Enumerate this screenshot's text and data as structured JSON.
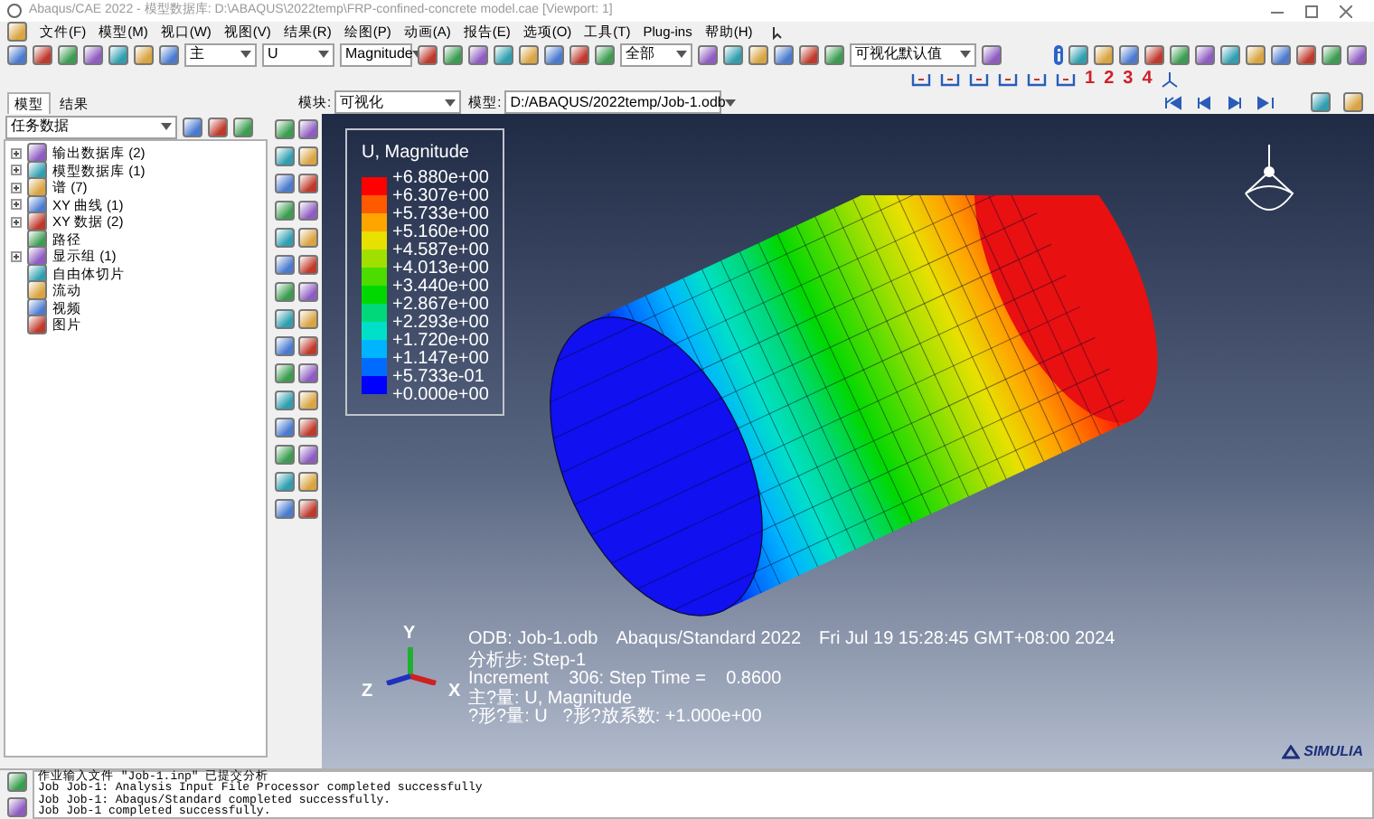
{
  "window": {
    "title": "Abaqus/CAE 2022 - 模型数据库: D:\\ABAQUS\\2022temp\\FRP-confined-concrete model.cae [Viewport: 1]"
  },
  "menu": [
    "文件(F)",
    "模型(M)",
    "视口(W)",
    "视图(V)",
    "结果(R)",
    "绘图(P)",
    "动画(A)",
    "报告(E)",
    "选项(O)",
    "工具(T)",
    "Plug-ins",
    "帮助(H)"
  ],
  "toolbar": {
    "step_combo": "主",
    "variable_combo": "U",
    "component_combo": "Magnitude",
    "selection_combo": "全部",
    "defaults_combo": "可视化默认值",
    "view_numbers": [
      "1",
      "2",
      "3",
      "4"
    ]
  },
  "context_bar": {
    "module_label": "模块:",
    "module": "可视化",
    "model_label": "模型:",
    "model": "D:/ABAQUS/2022temp/Job-1.odb"
  },
  "tabs": [
    {
      "label": "模型",
      "selected": true
    },
    {
      "label": "结果",
      "selected": false
    }
  ],
  "tree": {
    "filter": "任务数据",
    "items": [
      {
        "label": "输出数据库 (2)",
        "expandable": true
      },
      {
        "label": "模型数据库 (1)",
        "expandable": true
      },
      {
        "label": "谱 (7)",
        "expandable": true
      },
      {
        "label": "XY 曲线 (1)",
        "expandable": true
      },
      {
        "label": "XY 数据 (2)",
        "expandable": true
      },
      {
        "label": "路径",
        "expandable": false
      },
      {
        "label": "显示组 (1)",
        "expandable": true
      },
      {
        "label": "自由体切片",
        "expandable": false
      },
      {
        "label": "流动",
        "expandable": false
      },
      {
        "label": "视频",
        "expandable": false
      },
      {
        "label": "图片",
        "expandable": false
      }
    ]
  },
  "legend": {
    "title": "U, Magnitude",
    "values": [
      "+6.880e+00",
      "+6.307e+00",
      "+5.733e+00",
      "+5.160e+00",
      "+4.587e+00",
      "+4.013e+00",
      "+3.440e+00",
      "+2.867e+00",
      "+2.293e+00",
      "+1.720e+00",
      "+1.147e+00",
      "+5.733e-01",
      "+0.000e+00"
    ],
    "bands": [
      {
        "color": "#ff0000"
      },
      {
        "color": "#ff5a00"
      },
      {
        "color": "#ffa500"
      },
      {
        "color": "#e8e000"
      },
      {
        "color": "#a0e000"
      },
      {
        "color": "#4cdc00"
      },
      {
        "color": "#00d800"
      },
      {
        "color": "#00d87a"
      },
      {
        "color": "#00e0c8"
      },
      {
        "color": "#00b4ff"
      },
      {
        "color": "#006cff"
      },
      {
        "color": "#0000ff"
      }
    ]
  },
  "info": {
    "header": [
      "ODB: Job-1.odb",
      "Abaqus/Standard 2022",
      "Fri Jul 19 15:28:45 GMT+08:00 2024"
    ],
    "lines": [
      "分析步: Step-1",
      "Increment    306: Step Time =    0.8600",
      "主?量: U, Magnitude",
      "?形?量: U   ?形?放系数: +1.000e+00"
    ]
  },
  "triad": {
    "y": "Y",
    "x": "X",
    "z": "Z"
  },
  "brand": "SIMULIA",
  "messages": [
    "作业输入文件 \"Job-1.inp\" 已提交分析",
    "Job Job-1: Analysis Input File Processor completed successfully",
    "Job Job-1: Abaqus/Standard completed successfully.",
    "Job Job-1 completed successfully."
  ]
}
